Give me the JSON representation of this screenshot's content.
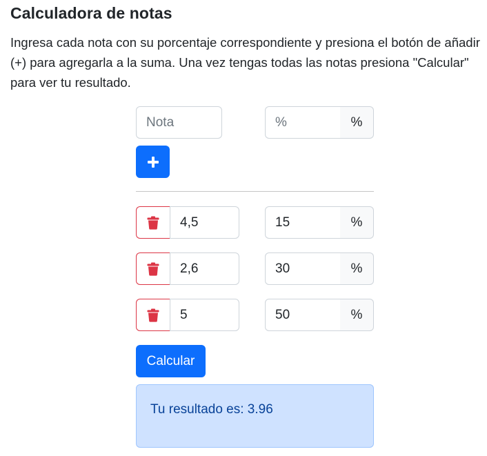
{
  "header": {
    "title": "Calculadora de notas",
    "description": "Ingresa cada nota con su porcentaje correspondiente y presiona el botón de añadir (+) para agregarla a la suma. Una vez tengas todas las notas presiona \"Calcular\" para ver tu resultado."
  },
  "new_entry": {
    "grade_placeholder": "Nota",
    "percent_placeholder": "%",
    "percent_suffix": "%",
    "add_icon": "plus-icon"
  },
  "entries": [
    {
      "grade": "4,5",
      "percent": "15",
      "suffix": "%",
      "delete_icon": "trash-icon"
    },
    {
      "grade": "2,6",
      "percent": "30",
      "suffix": "%",
      "delete_icon": "trash-icon"
    },
    {
      "grade": "5",
      "percent": "50",
      "suffix": "%",
      "delete_icon": "trash-icon"
    }
  ],
  "calculate_label": "Calcular",
  "result_text": "Tu resultado es: 3.96",
  "colors": {
    "primary": "#0d6efd",
    "danger": "#dc3545",
    "result_bg": "#cfe2ff",
    "result_text": "#084298"
  }
}
